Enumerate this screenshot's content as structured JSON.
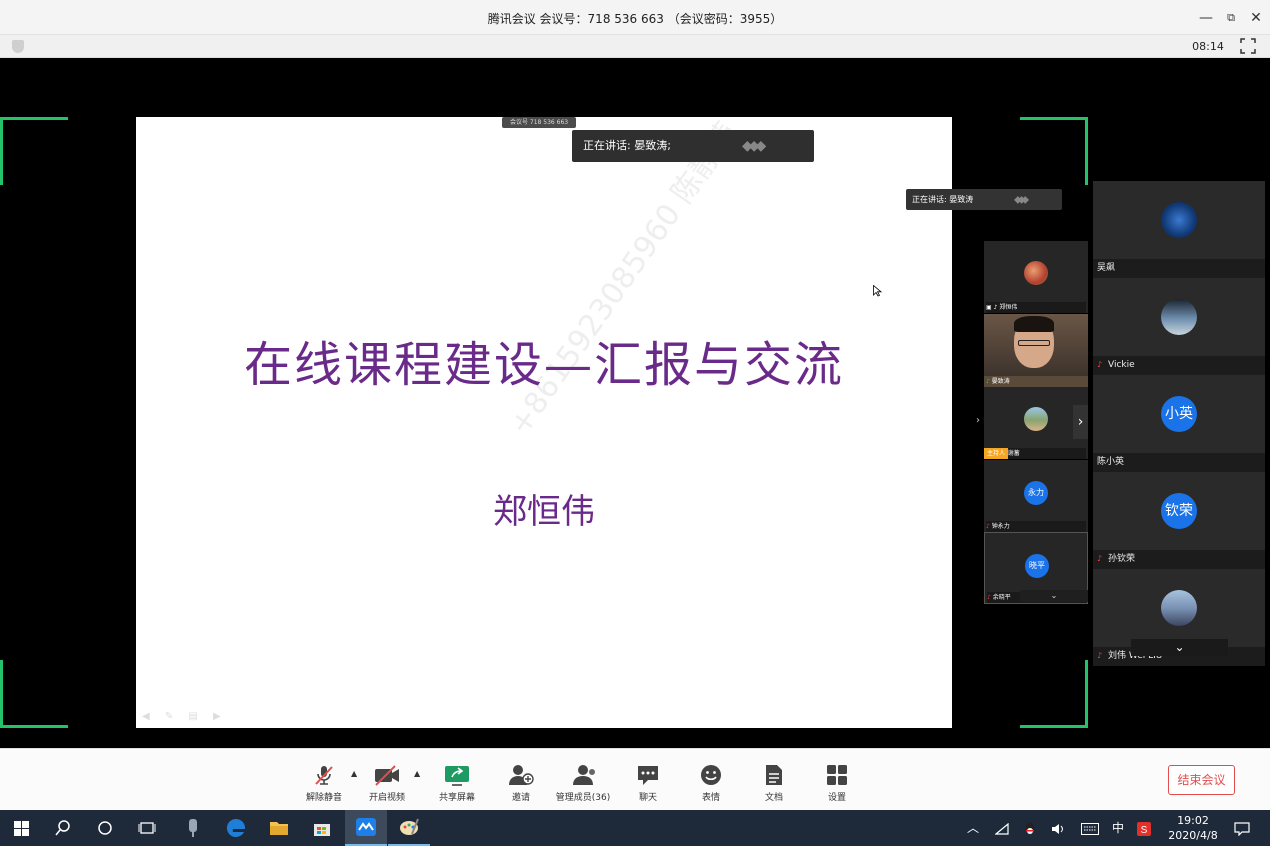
{
  "window": {
    "title": "腾讯会议 会议号：718 536 663 （会议密码：3955）",
    "minimize": "—",
    "restore": "⧉",
    "close": "✕"
  },
  "strip": {
    "timer": "08:14"
  },
  "slide": {
    "title": "在线课程建设—汇报与交流",
    "author": "郑恒伟",
    "watermark": "+8615923085960 陈静蒂"
  },
  "meeting_pill": "会议号 718 536 663",
  "speaker_tip": {
    "label": "正在讲话: 晏致涛;"
  },
  "speaker_tip_small": {
    "label": "正在讲话: 晏致涛"
  },
  "small_participants": [
    {
      "name": "郑恒伟"
    },
    {
      "name": "晏致涛"
    },
    {
      "name": "谢蓄",
      "host_badge": "主持人"
    },
    {
      "name": "钟永力",
      "initials": "永力"
    },
    {
      "name": "余晓平",
      "initials": "晓平"
    }
  ],
  "big_participants": [
    {
      "name": "吴飙"
    },
    {
      "name": "Vickie"
    },
    {
      "name": "陈小英",
      "initials": "小英"
    },
    {
      "name": "孙钦荣",
      "initials": "钦荣"
    },
    {
      "name": "刘伟 Wei LIU"
    }
  ],
  "toolbar": {
    "mute": "解除静音",
    "video": "开启视频",
    "share": "共享屏幕",
    "invite": "邀请",
    "members": "管理成员(36)",
    "chat": "聊天",
    "emoji": "表情",
    "docs": "文档",
    "settings": "设置",
    "end": "结束会议"
  },
  "taskbar": {
    "ime": "中",
    "time": "19:02",
    "date": "2020/4/8"
  },
  "colors": {
    "accent_green": "#22c36b",
    "slide_text": "#6a2a8a",
    "end_red": "#e34d4d",
    "avatar_blue": "#1a73e8"
  }
}
